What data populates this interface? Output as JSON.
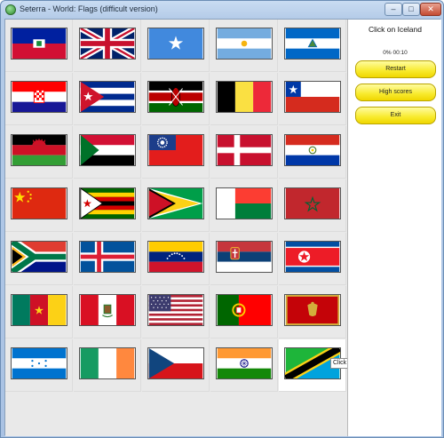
{
  "window": {
    "title": "Seterra - World: Flags (difficult version)",
    "minimize_glyph": "–",
    "maximize_glyph": "□",
    "close_glyph": "✕",
    "icon": "seterra-app-icon"
  },
  "panel": {
    "prompt": "Click on Iceland",
    "score": "0% 00:10",
    "restart_label": "Restart",
    "highscores_label": "High scores",
    "exit_label": "Exit",
    "button_color": "#f8ea2c"
  },
  "tooltip": "Click o",
  "flags": [
    [
      "haiti",
      "united-kingdom",
      "somalia",
      "argentina",
      "nicaragua"
    ],
    [
      "croatia",
      "cuba",
      "kenya",
      "belgium",
      "chile"
    ],
    [
      "malawi",
      "sudan",
      "myanmar-old",
      "denmark",
      "paraguay"
    ],
    [
      "china",
      "zimbabwe",
      "guyana",
      "madagascar",
      "morocco"
    ],
    [
      "south-africa",
      "iceland",
      "venezuela",
      "serbia",
      "north-korea"
    ],
    [
      "cameroon",
      "peru",
      "united-states",
      "portugal",
      "montenegro"
    ],
    [
      "honduras",
      "ireland",
      "czech-republic",
      "india",
      "tanzania"
    ]
  ]
}
